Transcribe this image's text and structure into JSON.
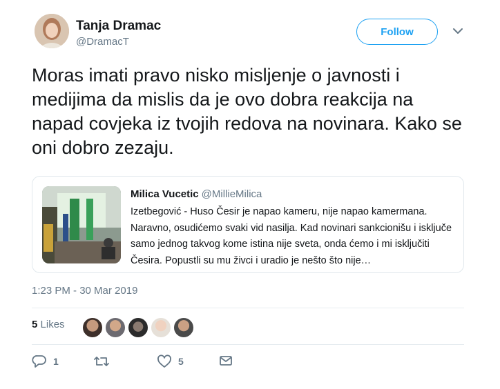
{
  "author": {
    "name": "Tanja Dramac",
    "handle": "@DramacT"
  },
  "follow_label": "Follow",
  "tweet_text": "Moras imati pravo nisko misljenje o javnosti i medijima da mislis da je ovo dobra reakcija na napad covjeka iz tvojih redova na novinara. Kako se oni dobro zezaju.",
  "quoted": {
    "name": "Milica Vucetic",
    "handle": "@MillieMilica",
    "text": "Izetbegović - Huso Česir je napao kameru, nije napao kamermana. Naravno, osudićemo svaki vid nasilja. Kad novinari sankcionišu i isključe samo jednog takvog kome istina nije sveta, onda ćemo i mi isključiti Česira. Popustli su mu živci i uradio je nešto što nije…"
  },
  "timestamp": "1:23 PM - 30 Mar 2019",
  "likes": {
    "count": "5",
    "label": "Likes"
  },
  "actions": {
    "reply_count": "1",
    "retweet_count": "",
    "like_count": "5"
  },
  "colors": {
    "accent": "#1da1f2",
    "secondary_text": "#657786",
    "divider": "#e6ecf0"
  }
}
